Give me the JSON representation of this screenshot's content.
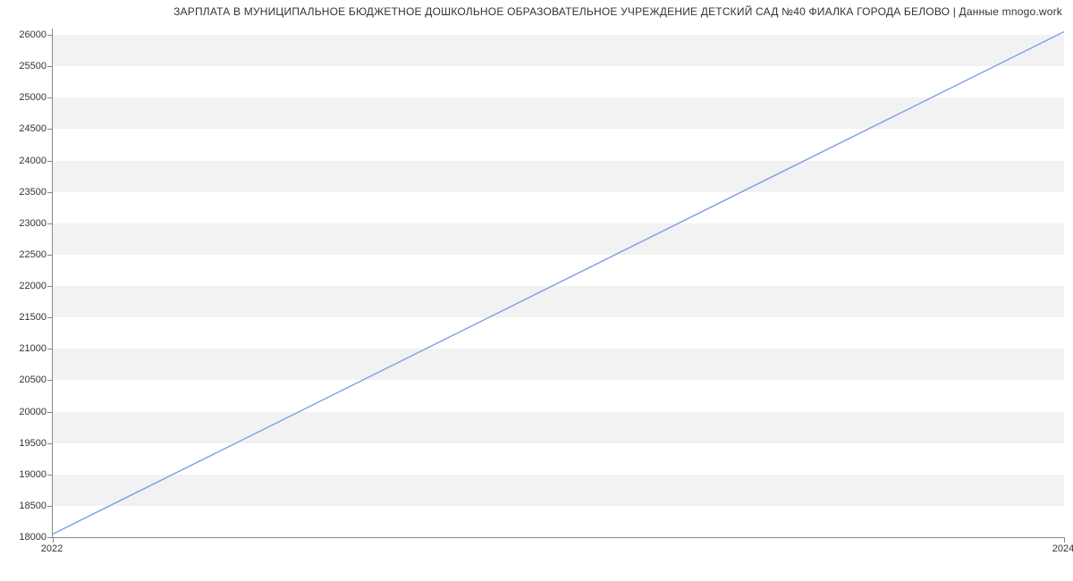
{
  "title": "ЗАРПЛАТА В МУНИЦИПАЛЬНОЕ БЮДЖЕТНОЕ ДОШКОЛЬНОЕ ОБРАЗОВАТЕЛЬНОЕ УЧРЕЖДЕНИЕ ДЕТСКИЙ САД №40 ФИАЛКА ГОРОДА БЕЛОВО | Данные mnogo.work",
  "chart_data": {
    "type": "line",
    "x": [
      2022,
      2024
    ],
    "values": [
      18050,
      26050
    ],
    "xlabel": "",
    "ylabel": "",
    "xlim": [
      2022,
      2024
    ],
    "ylim": [
      18000,
      26100
    ],
    "x_ticks": [
      2022,
      2024
    ],
    "y_ticks": [
      18000,
      18500,
      19000,
      19500,
      20000,
      20500,
      21000,
      21500,
      22000,
      22500,
      23000,
      23500,
      24000,
      24500,
      25000,
      25500,
      26000
    ],
    "grid_bands": true,
    "series_color": "#7a9fe6"
  }
}
